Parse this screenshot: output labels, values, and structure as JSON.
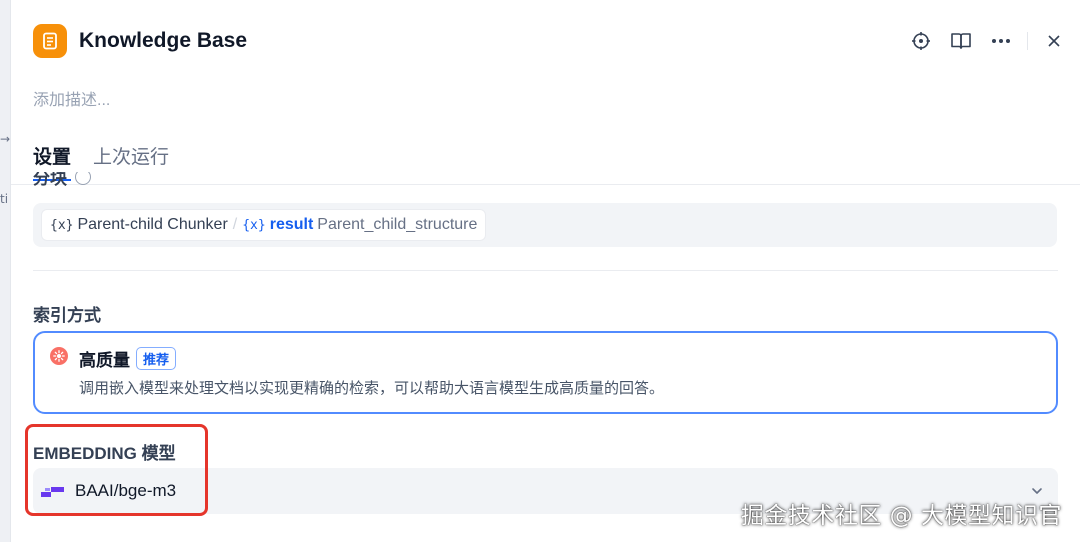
{
  "panel": {
    "title": "Knowledge Base",
    "description_placeholder": "添加描述...",
    "icon": "book-icon",
    "accent_color": "#f79009",
    "actions": [
      "locate-icon",
      "book-open-icon",
      "more-icon",
      "close-icon"
    ]
  },
  "tabs": [
    {
      "label": "设置",
      "active": true
    },
    {
      "label": "上次运行",
      "active": false
    }
  ],
  "chunk_section": {
    "label": "分块",
    "source_node": "Parent-child Chunker",
    "variable_name": "result",
    "variable_type": "Parent_child_structure"
  },
  "index_section": {
    "label": "索引方式",
    "option_title": "高质量",
    "option_badge": "推荐",
    "option_description": "调用嵌入模型来处理文档以实现更精确的检索，可以帮助大语言模型生成高质量的回答。",
    "selected_border_color": "#528bff"
  },
  "embedding_section": {
    "label": "EMBEDDING 模型",
    "selected_model": "BAAI/bge-m3",
    "model_icon": "siliconflow-icon"
  },
  "annotation": {
    "highlight_color": "#e5352b"
  },
  "watermark": "掘金技术社区 @ 大模型知识官",
  "background_glyphs": [
    "→",
    "ti"
  ]
}
